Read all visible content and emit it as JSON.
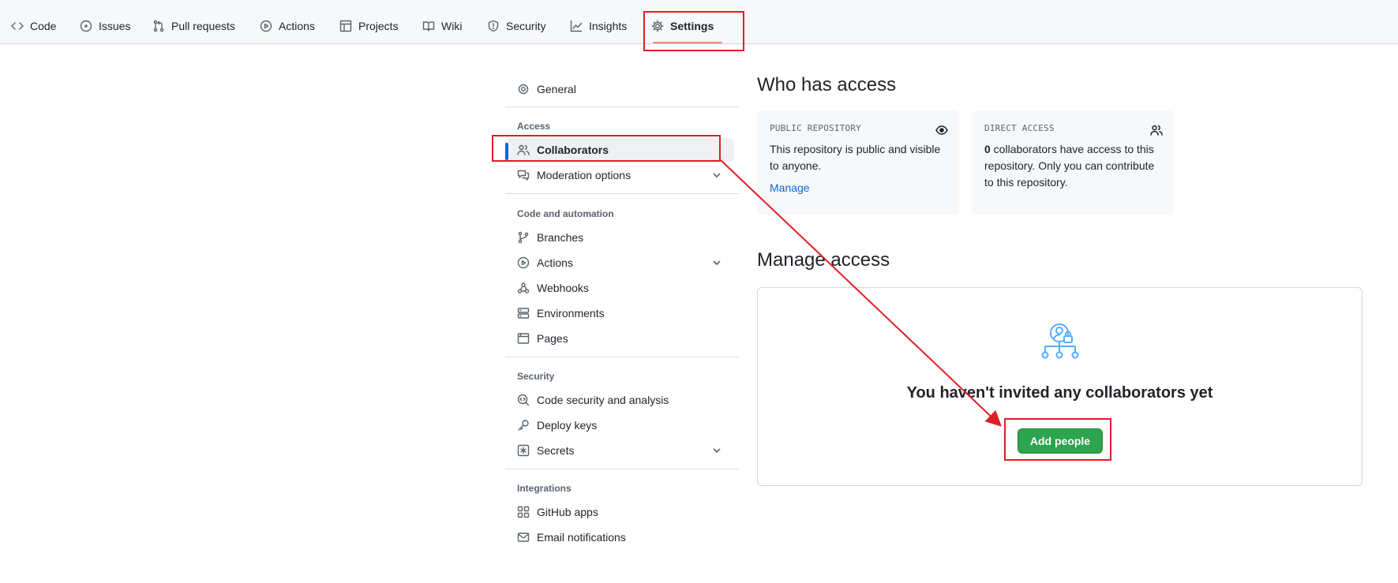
{
  "topnav": {
    "tabs": [
      {
        "label": "Code",
        "icon": "code-icon"
      },
      {
        "label": "Issues",
        "icon": "issue-icon"
      },
      {
        "label": "Pull requests",
        "icon": "pull-request-icon"
      },
      {
        "label": "Actions",
        "icon": "play-icon"
      },
      {
        "label": "Projects",
        "icon": "table-icon"
      },
      {
        "label": "Wiki",
        "icon": "book-icon"
      },
      {
        "label": "Security",
        "icon": "shield-icon"
      },
      {
        "label": "Insights",
        "icon": "graph-icon"
      },
      {
        "label": "Settings",
        "icon": "gear-icon",
        "active": true
      }
    ]
  },
  "sidebar": {
    "general": "General",
    "access_heading": "Access",
    "collaborators": "Collaborators",
    "moderation": "Moderation options",
    "code_heading": "Code and automation",
    "branches": "Branches",
    "actions": "Actions",
    "webhooks": "Webhooks",
    "environments": "Environments",
    "pages": "Pages",
    "security_heading": "Security",
    "code_security": "Code security and analysis",
    "deploy_keys": "Deploy keys",
    "secrets": "Secrets",
    "integrations_heading": "Integrations",
    "github_apps": "GitHub apps",
    "email_notifications": "Email notifications"
  },
  "main": {
    "who_title": "Who has access",
    "public_card": {
      "label": "PUBLIC REPOSITORY",
      "text": "This repository is public and visible to anyone.",
      "link": "Manage"
    },
    "direct_card": {
      "label": "DIRECT ACCESS",
      "count": "0",
      "text": " collaborators have access to this repository. Only you can contribute to this repository."
    },
    "manage_title": "Manage access",
    "empty_title": "You haven't invited any collaborators yet",
    "add_button": "Add people"
  },
  "colors": {
    "accent_blue": "#0969da",
    "primary_green": "#2da44e",
    "annotation_red": "#e01e26",
    "tab_underline": "#fd8c73"
  }
}
